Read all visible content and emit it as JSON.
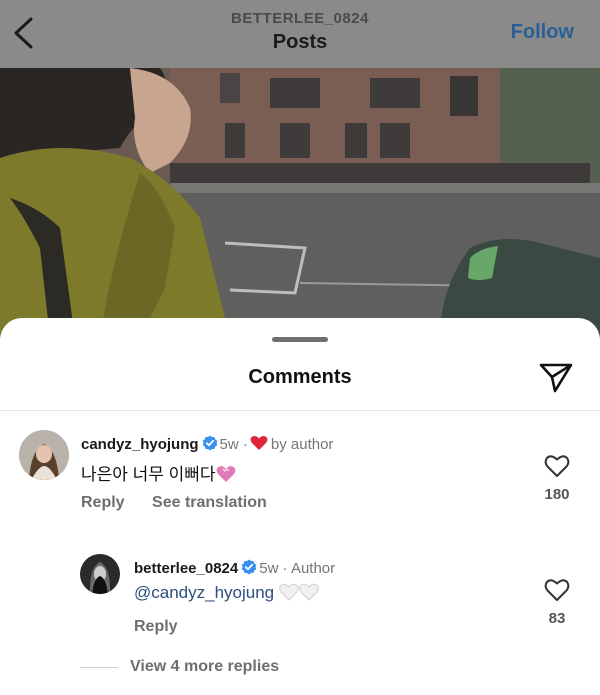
{
  "header": {
    "username": "BETTERLEE_0824",
    "title": "Posts",
    "follow_label": "Follow"
  },
  "sheet": {
    "title": "Comments"
  },
  "comments": [
    {
      "username": "candyz_hyojung",
      "verified": true,
      "time": "5w",
      "separator": "·",
      "liked_by_author_label": "by author",
      "text": "나은아 너무 이뻐다",
      "text_emoji": "pink-heart",
      "actions": [
        "Reply",
        "See translation"
      ],
      "likes": "180"
    },
    {
      "username": "betterlee_0824",
      "verified": true,
      "time": "5w",
      "separator": "·",
      "role": "Author",
      "mention": "@candyz_hyojung",
      "text_emoji": "white-heart",
      "actions": [
        "Reply"
      ],
      "likes": "83"
    }
  ],
  "more_replies_label": "View 4 more replies",
  "icons": {
    "back": "chevron-left-icon",
    "share": "paper-plane-icon",
    "like": "heart-outline-icon",
    "verified": "verified-badge-icon",
    "liked_by_author": "red-heart-icon"
  },
  "colors": {
    "follow": "#2a5f96",
    "verified": "#3a8ff0",
    "red_heart": "#e0243a",
    "pink_heart": "#e27ab8",
    "mention": "#2d4f7f"
  }
}
